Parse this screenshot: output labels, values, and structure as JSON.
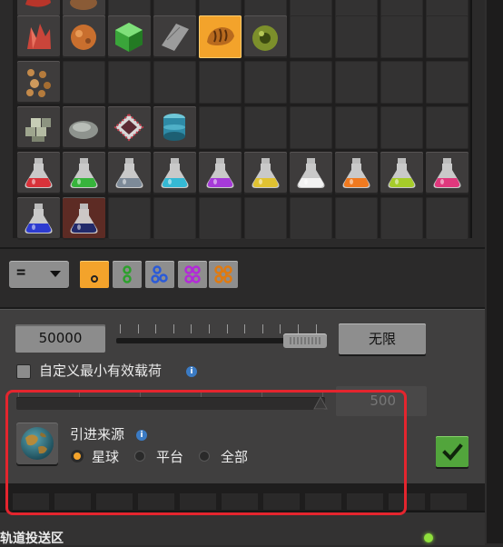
{
  "grid": {
    "rows": [
      [
        "ore-red",
        "rock-brown",
        "",
        "",
        "",
        "",
        "",
        "",
        "",
        ""
      ],
      [
        "crystal-red",
        "ore-orange",
        "cube-green",
        "metal-sheet",
        "bread",
        "egg-green",
        "",
        "",
        "",
        ""
      ],
      [
        "pebbles",
        "",
        "",
        "",
        "",
        "",
        "",
        "",
        "",
        ""
      ],
      [
        "stone-bricks",
        "stone-disc",
        "chip",
        "barrel-blue",
        "",
        "",
        "",
        "",
        "",
        ""
      ],
      [
        "flask-red",
        "flask-green",
        "flask-gray",
        "flask-cyan",
        "flask-purple",
        "flask-yellow",
        "flask-white",
        "flask-orange",
        "flask-lime",
        "flask-pink"
      ],
      [
        "flask-blue",
        "flask-navy",
        "",
        "",
        "",
        "",
        "",
        "",
        "",
        ""
      ]
    ],
    "selected": "bread"
  },
  "toolbar": {
    "comparator": "=",
    "quality_buttons": [
      "quality-1",
      "quality-2",
      "quality-3",
      "quality-4",
      "quality-5"
    ],
    "quality_selected": 0
  },
  "panel": {
    "amount_value": "50000",
    "unlimited_label": "无限",
    "min_payload_label": "自定义最小有效载荷",
    "min_payload_value": "500",
    "min_payload_checked": false,
    "import_source_label": "引进来源",
    "radio_options": [
      "星球",
      "平台",
      "全部"
    ],
    "radio_selected": 0,
    "info_glyph": "i"
  },
  "footer": {
    "section_title": "轨道投送区"
  },
  "colors": {
    "accent": "#f3a32b",
    "confirm": "#52a53c",
    "highlight_border": "#e4252e",
    "status_dot": "#8fe03c"
  }
}
